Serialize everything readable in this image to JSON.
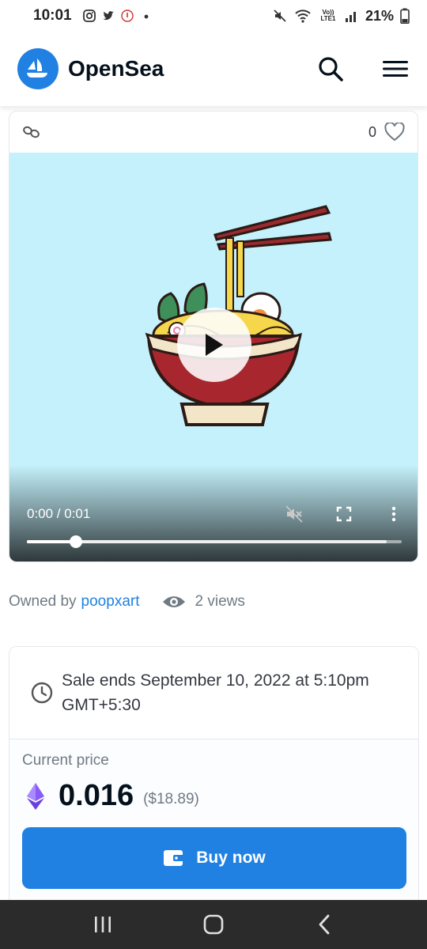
{
  "status": {
    "time": "10:01",
    "lte": "Vo)) LTE1",
    "battery": "21%"
  },
  "header": {
    "brand": "OpenSea",
    "icons": {
      "logo": "opensea-boat-icon",
      "search": "search-icon",
      "menu": "hamburger-menu-icon"
    }
  },
  "item": {
    "favorites_count": "0",
    "video": {
      "time": "0:00 / 0:01",
      "progress_fraction": 0.13,
      "buffered_fraction": 0.96
    },
    "colors": {
      "media_bg": "#c4f1fb"
    }
  },
  "owner": {
    "prefix": "Owned by",
    "name": "poopxart",
    "views": "2 views"
  },
  "trade": {
    "sale_ends": "Sale ends September 10, 2022 at 5:10pm GMT+5:30",
    "price_label": "Current price",
    "price": "0.016",
    "price_fiat": "($18.89)",
    "buy_label": "Buy now"
  },
  "colors": {
    "accent": "#2081e2",
    "text_primary": "#04111d",
    "text_secondary": "#707a83"
  }
}
